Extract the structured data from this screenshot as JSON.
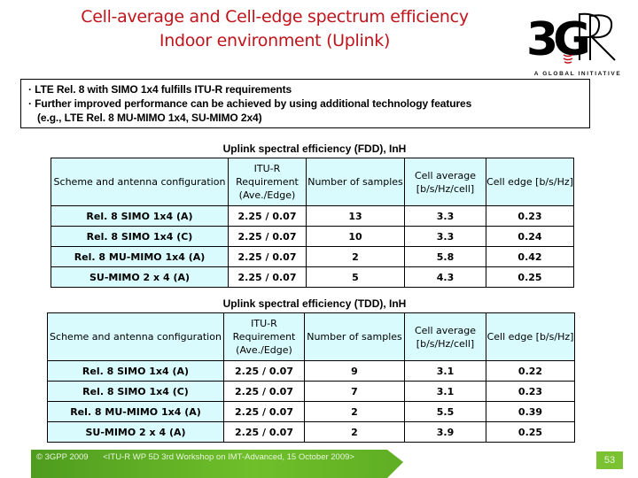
{
  "slide": {
    "title_line1": "Cell-average and Cell-edge spectrum efficiency",
    "title_line2": "Indoor environment (Uplink)",
    "title_color": "#c0141c"
  },
  "logo": {
    "mark": "3GPP",
    "tagline": "A GLOBAL INITIATIVE"
  },
  "bullets": {
    "items": [
      "LTE Rel. 8 with SIMO 1x4 fulfills ITU-R requirements",
      "Further improved performance can be achieved by using additional technology features"
    ],
    "continuation": "(e.g., LTE Rel. 8 MU-MIMO 1x4, SU-MIMO 2x4)"
  },
  "tables": [
    {
      "caption": "Uplink spectral efficiency (FDD), InH",
      "headers": [
        "Scheme and antenna configuration",
        "ITU-R Requirement (Ave./Edge)",
        "Number of samples",
        "Cell average [b/s/Hz/cell]",
        "Cell edge [b/s/Hz]"
      ],
      "rows": [
        [
          "Rel. 8 SIMO 1x4 (A)",
          "2.25 / 0.07",
          "13",
          "3.3",
          "0.23"
        ],
        [
          "Rel. 8 SIMO 1x4 (C)",
          "2.25 / 0.07",
          "10",
          "3.3",
          "0.24"
        ],
        [
          "Rel. 8 MU-MIMO 1x4 (A)",
          "2.25 / 0.07",
          "2",
          "5.8",
          "0.42"
        ],
        [
          "SU-MIMO 2 x 4 (A)",
          "2.25 / 0.07",
          "5",
          "4.3",
          "0.25"
        ]
      ]
    },
    {
      "caption": "Uplink spectral efficiency (TDD), InH",
      "headers": [
        "Scheme and antenna configuration",
        "ITU-R Requirement (Ave./Edge)",
        "Number of samples",
        "Cell average [b/s/Hz/cell]",
        "Cell edge [b/s/Hz]"
      ],
      "rows": [
        [
          "Rel. 8 SIMO 1x4 (A)",
          "2.25 / 0.07",
          "9",
          "3.1",
          "0.22"
        ],
        [
          "Rel. 8 SIMO 1x4 (C)",
          "2.25 / 0.07",
          "7",
          "3.1",
          "0.23"
        ],
        [
          "Rel. 8 MU-MIMO 1x4 (A)",
          "2.25 / 0.07",
          "2",
          "5.5",
          "0.39"
        ],
        [
          "SU-MIMO 2 x 4 (A)",
          "2.25 / 0.07",
          "2",
          "3.9",
          "0.25"
        ]
      ]
    }
  ],
  "footer": {
    "copyright": "© 3GPP 2009",
    "event": "<ITU-R WP 5D 3rd Workshop on IMT-Advanced, 15 October 2009>",
    "page_number": "53",
    "accent_color": "#6fbf2a"
  }
}
